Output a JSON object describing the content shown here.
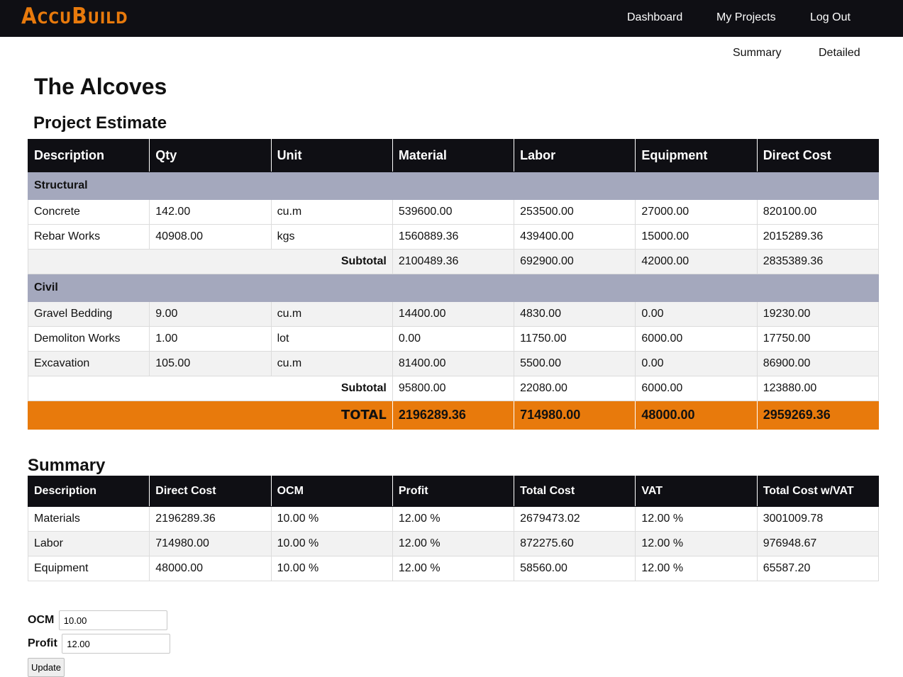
{
  "brand": {
    "logo": "AccuBuild"
  },
  "nav": {
    "items": [
      "Dashboard",
      "My Projects",
      "Log Out"
    ]
  },
  "subnav": {
    "items": [
      "Summary",
      "Detailed"
    ]
  },
  "project": {
    "title": "The Alcoves",
    "section_title": "Project Estimate"
  },
  "estimate": {
    "headers": [
      "Description",
      "Qty",
      "Unit",
      "Material",
      "Labor",
      "Equipment",
      "Direct Cost"
    ],
    "categories": [
      {
        "name": "Structural",
        "items": [
          [
            "Concrete",
            "142.00",
            "cu.m",
            "539600.00",
            "253500.00",
            "27000.00",
            "820100.00"
          ],
          [
            "Rebar Works",
            "40908.00",
            "kgs",
            "1560889.36",
            "439400.00",
            "15000.00",
            "2015289.36"
          ]
        ],
        "subtotal_label": "Subtotal",
        "subtotal": [
          "2100489.36",
          "692900.00",
          "42000.00",
          "2835389.36"
        ]
      },
      {
        "name": "Civil",
        "items": [
          [
            "Gravel Bedding",
            "9.00",
            "cu.m",
            "14400.00",
            "4830.00",
            "0.00",
            "19230.00"
          ],
          [
            "Demoliton Works",
            "1.00",
            "lot",
            "0.00",
            "11750.00",
            "6000.00",
            "17750.00"
          ],
          [
            "Excavation",
            "105.00",
            "cu.m",
            "81400.00",
            "5500.00",
            "0.00",
            "86900.00"
          ]
        ],
        "subtotal_label": "Subtotal",
        "subtotal": [
          "95800.00",
          "22080.00",
          "6000.00",
          "123880.00"
        ]
      }
    ],
    "total_label": "TOTAL",
    "total": [
      "2196289.36",
      "714980.00",
      "48000.00",
      "2959269.36"
    ]
  },
  "summary": {
    "title": "Summary",
    "headers": [
      "Description",
      "Direct Cost",
      "OCM",
      "Profit",
      "Total Cost",
      "VAT",
      "Total Cost w/VAT"
    ],
    "rows": [
      [
        "Materials",
        "2196289.36",
        "10.00 %",
        "12.00 %",
        "2679473.02",
        "12.00 %",
        "3001009.78"
      ],
      [
        "Labor",
        "714980.00",
        "10.00 %",
        "12.00 %",
        "872275.60",
        "12.00 %",
        "976948.67"
      ],
      [
        "Equipment",
        "48000.00",
        "10.00 %",
        "12.00 %",
        "58560.00",
        "12.00 %",
        "65587.20"
      ]
    ]
  },
  "form": {
    "ocm_label": "OCM",
    "ocm_value": "10.00",
    "profit_label": "Profit",
    "profit_value": "12.00",
    "update_label": "Update"
  },
  "colors": {
    "accent": "#e87a0c",
    "header_bg": "#0f0f14",
    "category_bg": "#a4a8bd",
    "row_alt": "#f2f2f2"
  }
}
